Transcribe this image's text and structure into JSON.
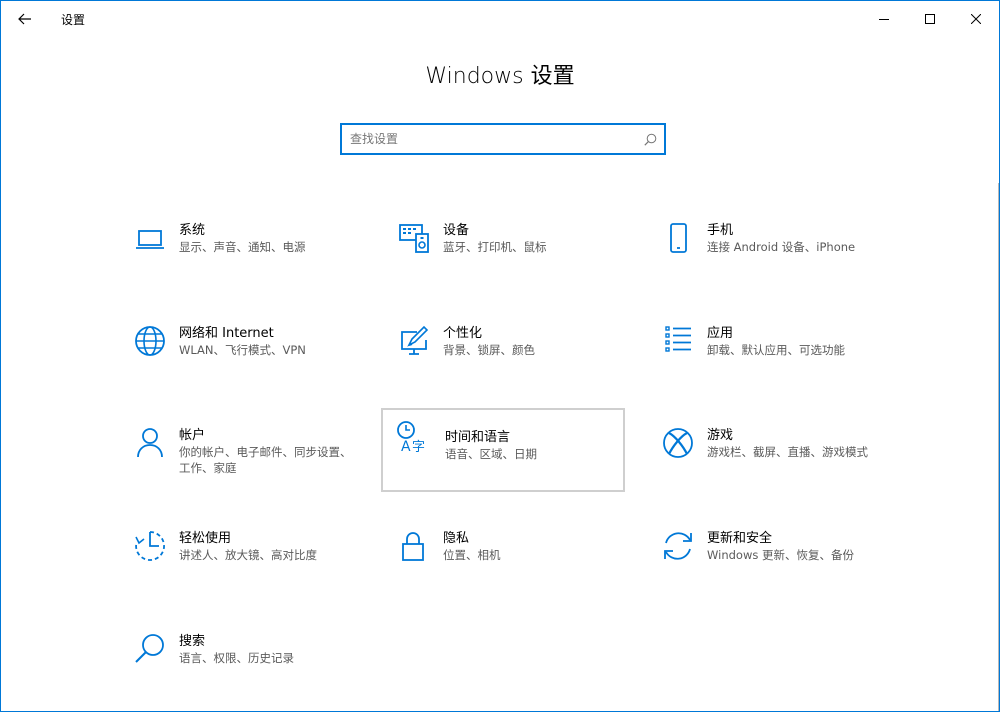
{
  "window": {
    "title": "设置"
  },
  "heading": "Windows 设置",
  "search": {
    "placeholder": "查找设置",
    "value": ""
  },
  "accent_color": "#0078d7",
  "tiles": [
    {
      "name": "系统",
      "desc": "显示、声音、通知、电源",
      "icon": "laptop-icon"
    },
    {
      "name": "设备",
      "desc": "蓝牙、打印机、鼠标",
      "icon": "devices-icon"
    },
    {
      "name": "手机",
      "desc": "连接 Android 设备、iPhone",
      "icon": "phone-icon"
    },
    {
      "name": "网络和 Internet",
      "desc": "WLAN、飞行模式、VPN",
      "icon": "globe-icon"
    },
    {
      "name": "个性化",
      "desc": "背景、锁屏、颜色",
      "icon": "paint-icon"
    },
    {
      "name": "应用",
      "desc": "卸载、默认应用、可选功能",
      "icon": "apps-list-icon"
    },
    {
      "name": "帐户",
      "desc": "你的帐户、电子邮件、同步设置、工作、家庭",
      "icon": "person-icon"
    },
    {
      "name": "时间和语言",
      "desc": "语音、区域、日期",
      "icon": "time-language-icon"
    },
    {
      "name": "游戏",
      "desc": "游戏栏、截屏、直播、游戏模式",
      "icon": "xbox-icon"
    },
    {
      "name": "轻松使用",
      "desc": "讲述人、放大镜、高对比度",
      "icon": "ease-of-access-icon"
    },
    {
      "name": "隐私",
      "desc": "位置、相机",
      "icon": "lock-icon"
    },
    {
      "name": "更新和安全",
      "desc": "Windows 更新、恢复、备份",
      "icon": "update-icon"
    },
    {
      "name": "搜索",
      "desc": "语言、权限、历史记录",
      "icon": "search-icon"
    }
  ]
}
